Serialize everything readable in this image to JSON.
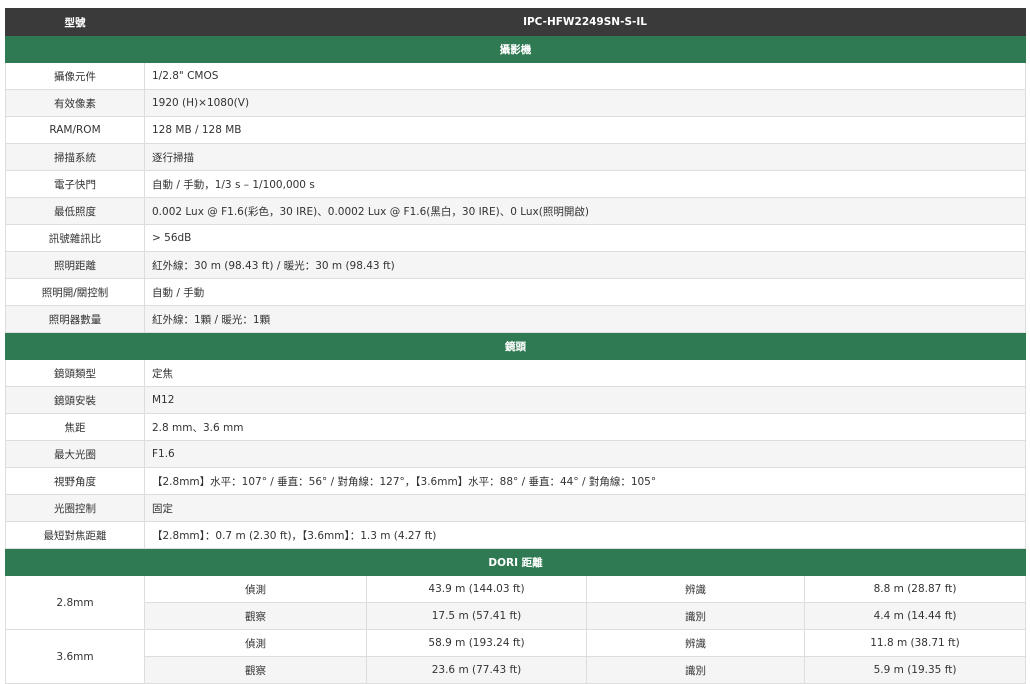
{
  "header": {
    "label": "型號",
    "model": "IPC-HFW2249SN-S-IL"
  },
  "sections": {
    "camera": "攝影機",
    "lens": "鏡頭",
    "dori": "DORI 距離"
  },
  "camera_rows": [
    {
      "label": "攝像元件",
      "value": "1/2.8\" CMOS"
    },
    {
      "label": "有效像素",
      "value": "1920 (H)×1080(V)"
    },
    {
      "label": "RAM/ROM",
      "value": "128 MB / 128 MB"
    },
    {
      "label": "掃描系統",
      "value": "逐行掃描"
    },
    {
      "label": "電子快門",
      "value": "自動 / 手動，1/3 s – 1/100,000 s"
    },
    {
      "label": "最低照度",
      "value": "0.002 Lux @ F1.6(彩色，30 IRE)、0.0002 Lux @ F1.6(黑白，30 IRE)、0 Lux(照明開啟)"
    },
    {
      "label": "訊號雜訊比",
      "value": "> 56dB"
    },
    {
      "label": "照明距離",
      "value": "紅外線：30 m (98.43 ft) / 暖光：30 m (98.43 ft)"
    },
    {
      "label": "照明開/關控制",
      "value": "自動 / 手動"
    },
    {
      "label": "照明器數量",
      "value": "紅外線：1顆 / 暖光：1顆"
    }
  ],
  "lens_rows": [
    {
      "label": "鏡頭類型",
      "value": "定焦"
    },
    {
      "label": "鏡頭安裝",
      "value": "M12"
    },
    {
      "label": "焦距",
      "value": "2.8 mm、3.6 mm"
    },
    {
      "label": "最大光圈",
      "value": "F1.6"
    },
    {
      "label": "視野角度",
      "value": "【2.8mm】水平：107° / 垂直：56° / 對角線：127°，【3.6mm】水平：88° / 垂直：44° / 對角線：105°"
    },
    {
      "label": "光圈控制",
      "value": "固定"
    },
    {
      "label": "最短對焦距離",
      "value": "【2.8mm】：0.7 m (2.30 ft)，【3.6mm】：1.3 m (4.27 ft)"
    }
  ],
  "dori": [
    {
      "lens": "2.8mm",
      "rows": [
        {
          "k1": "偵測",
          "v1": "43.9 m (144.03 ft)",
          "k2": "辨識",
          "v2": "8.8 m (28.87 ft)"
        },
        {
          "k1": "觀察",
          "v1": "17.5 m (57.41 ft)",
          "k2": "識別",
          "v2": "4.4 m (14.44 ft)"
        }
      ]
    },
    {
      "lens": "3.6mm",
      "rows": [
        {
          "k1": "偵測",
          "v1": "58.9 m (193.24 ft)",
          "k2": "辨識",
          "v2": "11.8 m (38.71 ft)"
        },
        {
          "k1": "觀察",
          "v1": "23.6 m (77.43 ft)",
          "k2": "識別",
          "v2": "5.9 m (19.35 ft)"
        }
      ]
    }
  ]
}
